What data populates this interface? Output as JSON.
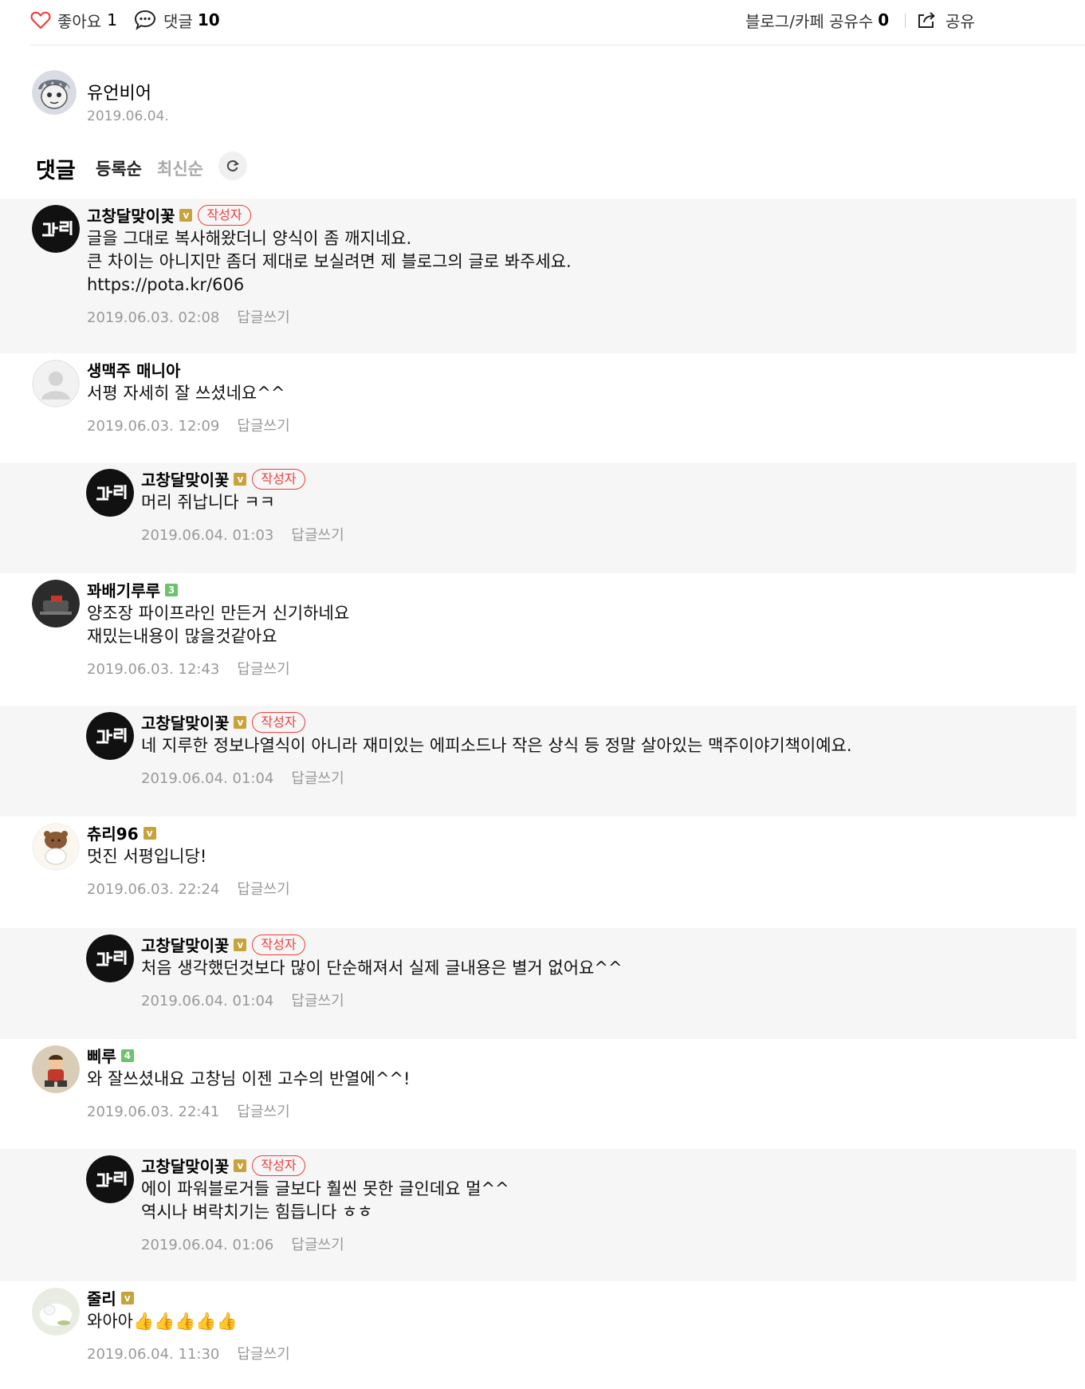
{
  "topbar": {
    "like_label": "좋아요",
    "like_count": "1",
    "comment_label": "댓글",
    "comment_count": "10",
    "share_count_label": "블로그/카페 공유수",
    "share_count": "0",
    "share_label": "공유"
  },
  "post_author": {
    "name": "유언비어",
    "date": "2019.06.04."
  },
  "comments_header": {
    "title": "댓글",
    "sort_registered": "등록순",
    "sort_latest": "최신순"
  },
  "author_badge": "작성자",
  "reply_label": "답글쓰기",
  "comments": [
    {
      "name": "고창달맞이꽃",
      "text": "글을 그대로 복사해왔더니 양식이 좀 깨지네요.\n큰 차이는 아니지만 좀더 제대로 보실려면 제 블로그의 글로 봐주세요.\nhttps://pota.kr/606",
      "date": "2019.06.03. 02:08"
    },
    {
      "name": "생맥주 매니아",
      "text": "서평 자세히 잘 쓰셨네요^^",
      "date": "2019.06.03. 12:09"
    },
    {
      "name": "고창달맞이꽃",
      "text": "머리 쥐납니다 ㅋㅋ",
      "date": "2019.06.04. 01:03"
    },
    {
      "name": "꽈배기루루",
      "badge": "3",
      "text": "양조장 파이프라인 만든거 신기하네요\n재밌는내용이 많을것같아요",
      "date": "2019.06.03. 12:43"
    },
    {
      "name": "고창달맞이꽃",
      "text": "네 지루한 정보나열식이 아니라 재미있는 에피소드나 작은 상식 등 정말 살아있는 맥주이야기책이예요.",
      "date": "2019.06.04. 01:04"
    },
    {
      "name": "츄리96",
      "text": "멋진 서평입니당!",
      "date": "2019.06.03. 22:24"
    },
    {
      "name": "고창달맞이꽃",
      "text": "처음 생각했던것보다 많이 단순해져서 실제 글내용은 별거 없어요^^",
      "date": "2019.06.04. 01:04"
    },
    {
      "name": "삐루",
      "badge": "4",
      "text": "와 잘쓰셨내요 고창님 이젠 고수의 반열에^^!",
      "date": "2019.06.03. 22:41"
    },
    {
      "name": "고창달맞이꽃",
      "text": "에이 파워블로거들 글보다 훨씬 못한 글인데요 멀^^\n역시나 벼락치기는 힘듭니다 ㅎㅎ",
      "date": "2019.06.04. 01:06"
    },
    {
      "name": "줄리",
      "text": "와아아👍👍👍👍👍",
      "date": "2019.06.04. 11:30"
    }
  ],
  "colors": {
    "accent_red": "#f03e3e",
    "badge_gold": "#c8a23a",
    "badge_green": "#6cc36c",
    "muted_text": "#999999",
    "gray_background": "#f6f6f6"
  }
}
